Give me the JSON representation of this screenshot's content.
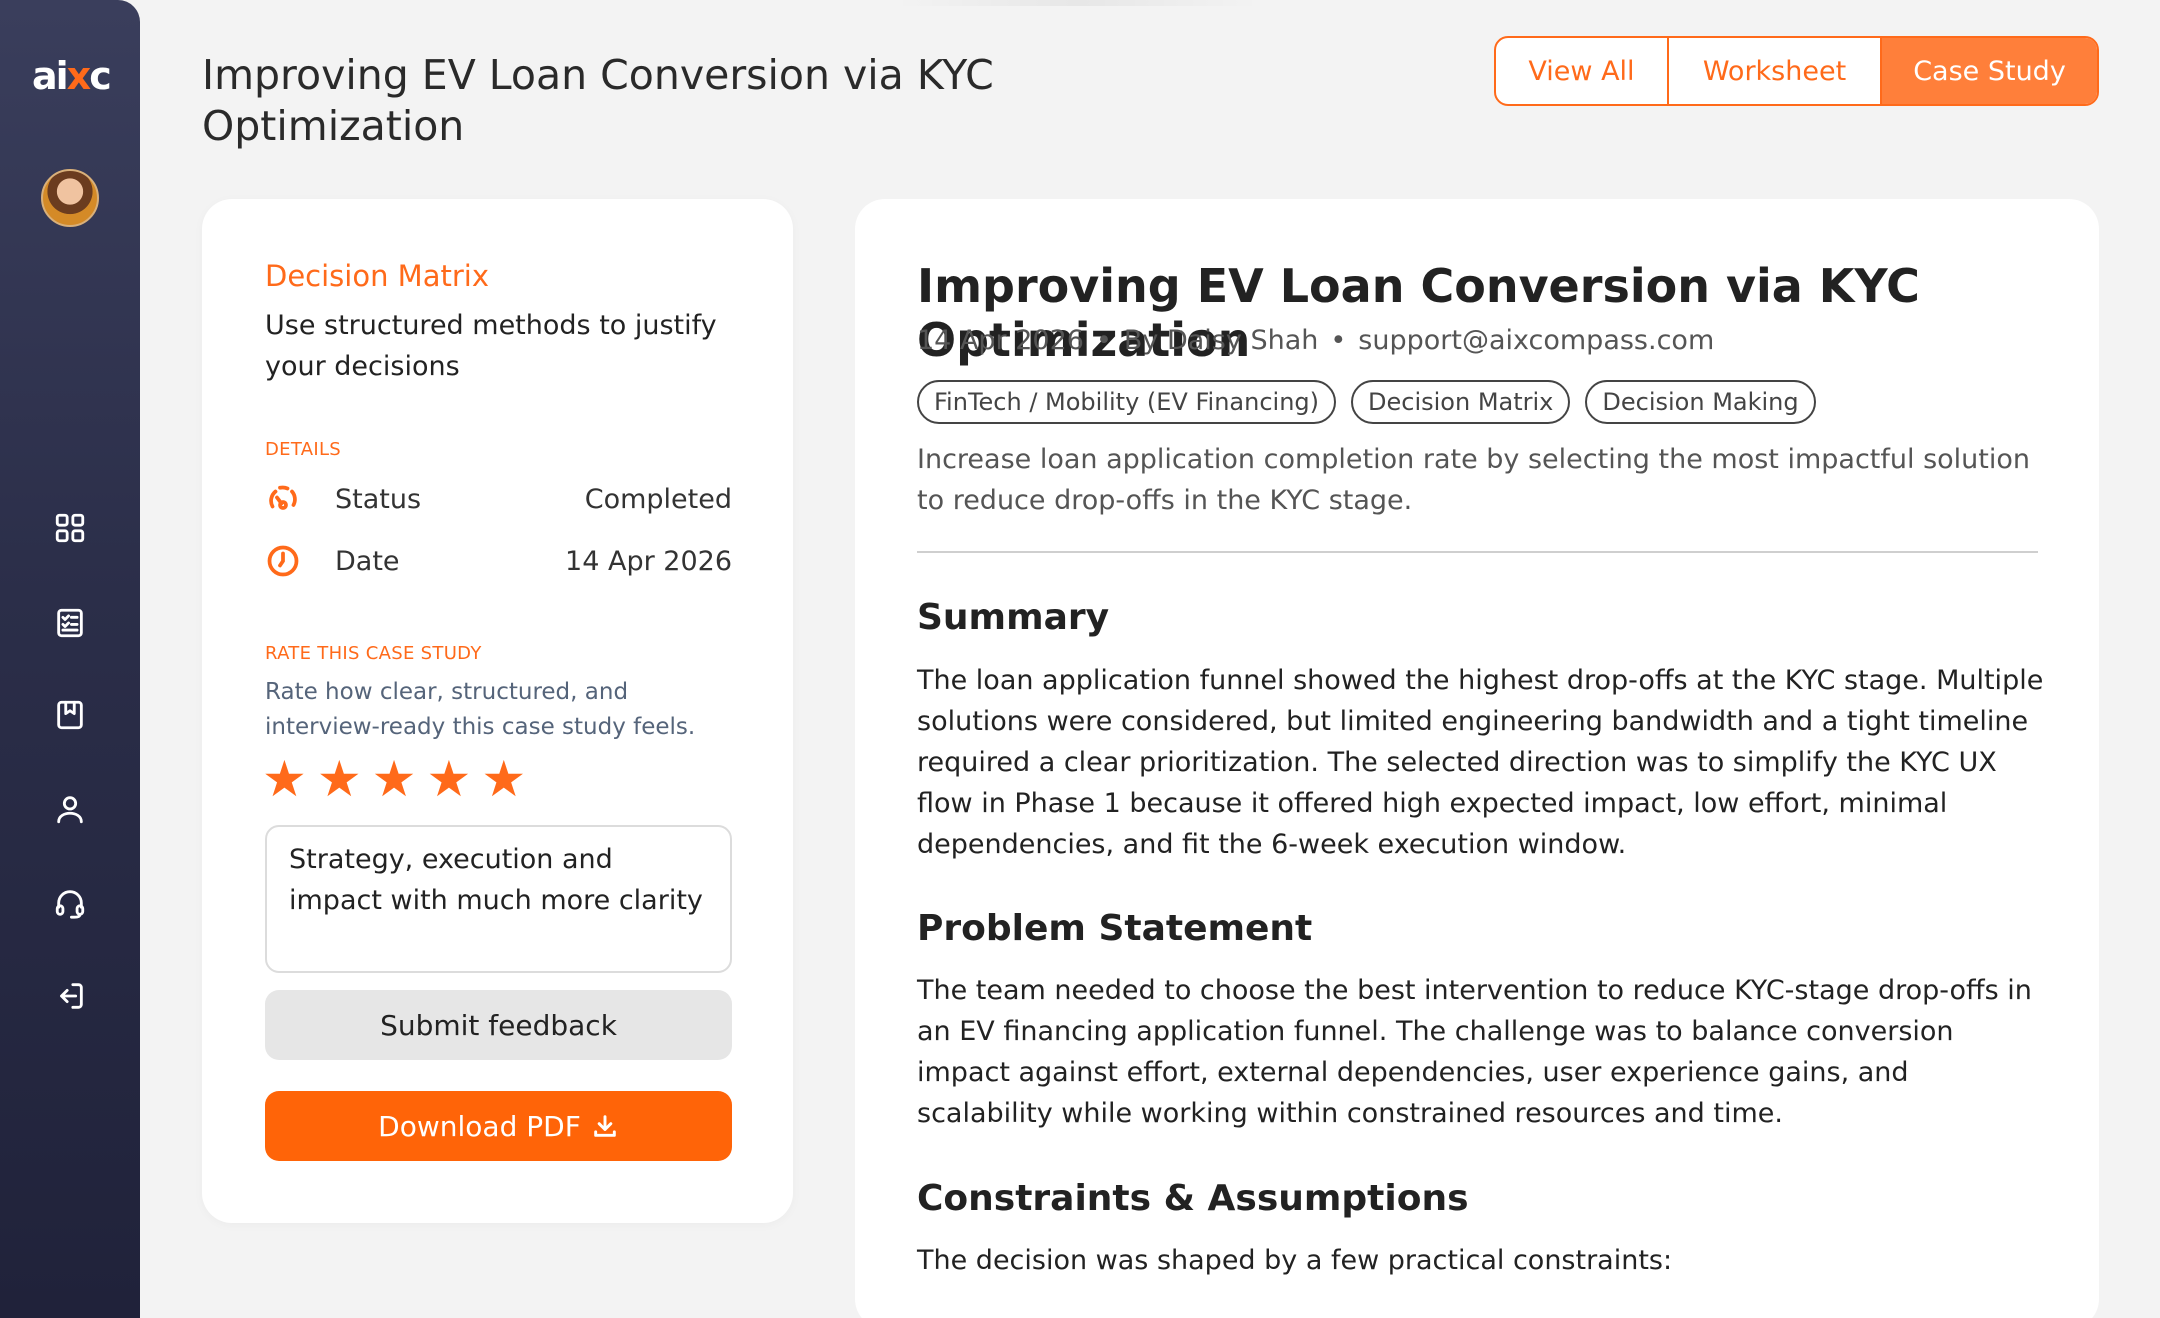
{
  "app": {
    "logo_a": "ai",
    "logo_x": "x",
    "logo_c": "c"
  },
  "header": {
    "title": "Improving EV Loan Conversion via KYC Optimization"
  },
  "tabs": [
    {
      "label": "View All"
    },
    {
      "label": "Worksheet"
    },
    {
      "label": "Case Study",
      "active": true
    }
  ],
  "sidebar": {
    "icons": [
      "grid-icon",
      "checklist-icon",
      "bookmark-icon",
      "user-icon",
      "headset-icon",
      "logout-icon"
    ]
  },
  "left_card": {
    "title": "Decision Matrix",
    "subtitle": "Use structured methods to justify your decisions",
    "details_label": "DETAILS",
    "details": [
      {
        "key": "Status",
        "value": "Completed",
        "icon": "status-icon"
      },
      {
        "key": "Date",
        "value": "14 Apr 2026",
        "icon": "clock-icon"
      }
    ],
    "rate_label": "RATE THIS CASE STUDY",
    "rate_desc": "Rate how clear, structured, and interview-ready this case study feels.",
    "rating": {
      "value": 5,
      "max": 5,
      "glyph": "★"
    },
    "feedback_text": "Strategy, execution and impact with much more clarity",
    "submit_label": "Submit feedback",
    "download_label": "Download PDF"
  },
  "article": {
    "title": "Improving EV Loan Conversion via KYC Optimization",
    "date": "14 Apr 2026",
    "bullet": "•",
    "author": "By Daisy Shah",
    "email": "support@aixcompass.com",
    "tags": [
      "FinTech / Mobility (EV Financing)",
      "Decision Matrix",
      "Decision Making"
    ],
    "description": "Increase loan application completion rate by selecting the most impactful solution to reduce drop-offs in the KYC stage.",
    "sections": [
      {
        "heading": "Summary",
        "body": "The loan application funnel showed the highest drop-offs at the KYC stage. Multiple solutions were considered, but limited engineering bandwidth and a tight timeline required a clear prioritization. The selected direction was to simplify the KYC UX flow in Phase 1 because it offered high expected impact, low effort, minimal dependencies, and fit the 6-week execution window."
      },
      {
        "heading": "Problem Statement",
        "body": "The team needed to choose the best intervention to reduce KYC-stage drop-offs in an EV financing application funnel. The challenge was to balance conversion impact against effort, external dependencies, user experience gains, and scalability while working within constrained resources and time."
      },
      {
        "heading": "Constraints & Assumptions",
        "body": "The decision was shaped by a few practical constraints:"
      }
    ]
  },
  "colors": {
    "accent": "#ff6a1a",
    "sidebar": "#2b2e49",
    "button_gray": "#e6e6e6"
  }
}
